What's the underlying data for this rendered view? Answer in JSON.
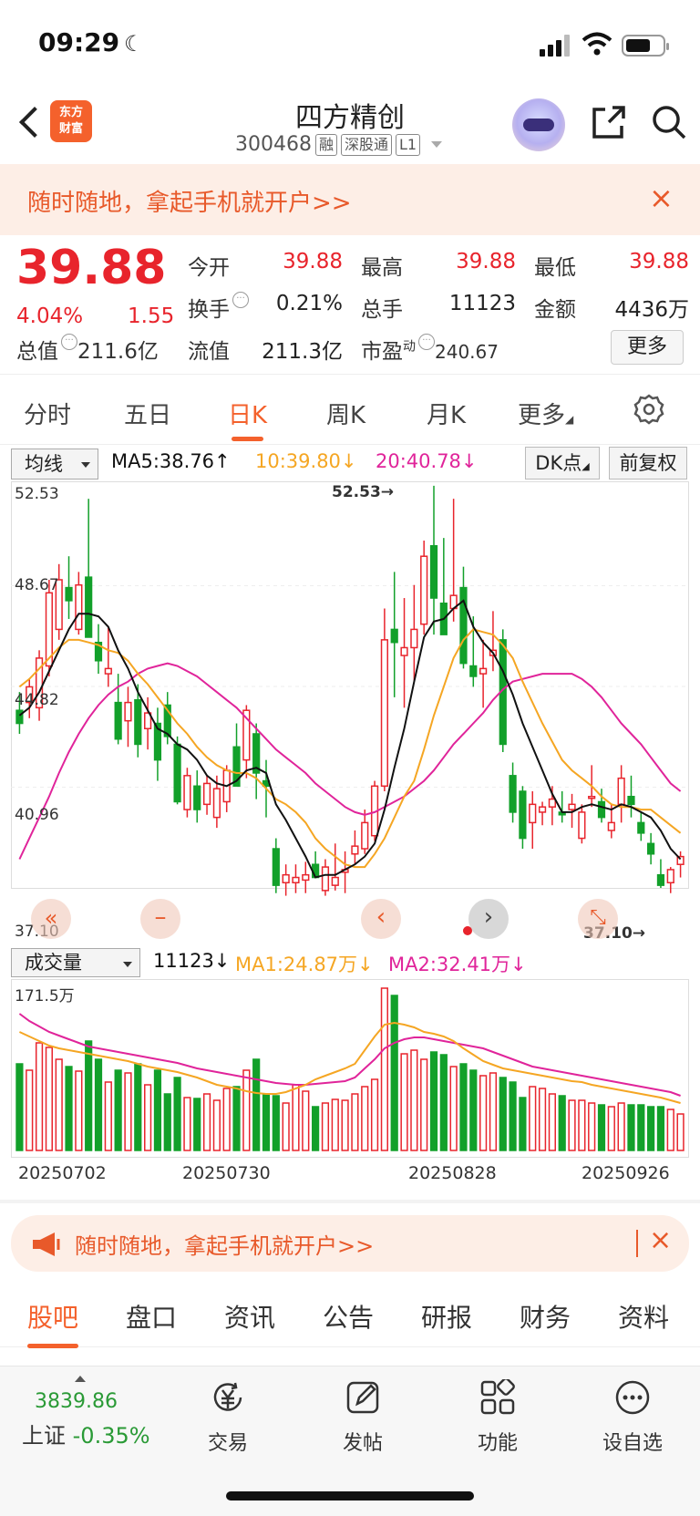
{
  "status": {
    "time": "09:29"
  },
  "nav": {
    "logo": "东方\n财富",
    "name": "四方精创",
    "code": "300468",
    "tags": [
      "融",
      "深股通",
      "L1"
    ]
  },
  "banner": {
    "text": "随时随地，拿起手机就开户>>",
    "close": "×"
  },
  "quote": {
    "price": "39.88",
    "pct": "4.04%",
    "chg": "1.55",
    "open_l": "今开",
    "open_v": "39.88",
    "high_l": "最高",
    "high_v": "39.88",
    "low_l": "最低",
    "low_v": "39.88",
    "turn_l": "换手",
    "turn_v": "0.21%",
    "vol_l": "总手",
    "vol_v": "11123",
    "amt_l": "金额",
    "amt_v": "4436万",
    "mcap_l": "总值",
    "mcap_v": "211.6亿",
    "fcap_l": "流值",
    "fcap_v": "211.3亿",
    "pe_l": "市盈",
    "pe_sup": "动",
    "pe_v": "240.67",
    "more": "更多"
  },
  "tabs": [
    "分时",
    "五日",
    "日K",
    "周K",
    "月K",
    "更多"
  ],
  "ma": {
    "select": "均线",
    "ma5": "MA5:38.76↑",
    "ma10": "10:39.80↓",
    "ma20": "20:40.78↓",
    "dk": "DK点",
    "fq": "前复权"
  },
  "chart_labels": {
    "y1": "52.53",
    "y2": "48.67",
    "y3": "44.82",
    "y4": "40.96",
    "y5": "37.10",
    "hi": "52.53→",
    "lo": "37.10→"
  },
  "vol": {
    "select": "成交量",
    "val": "11123↓",
    "ma1": "MA1:24.87万↓",
    "ma2": "MA2:32.41万↓",
    "ymax": "171.5万"
  },
  "dates": [
    "20250702",
    "20250730",
    "20250828",
    "20250926"
  ],
  "banner2": {
    "text": "随时随地，拿起手机就开户>>",
    "close": "×"
  },
  "ctabs": [
    "股吧",
    "盘口",
    "资讯",
    "公告",
    "研报",
    "财务",
    "资料"
  ],
  "bottom": {
    "idx": "3839.86",
    "idx_name": "上证",
    "idx_chg": "-0.35%",
    "btns": [
      "交易",
      "发帖",
      "功能",
      "设自选"
    ]
  },
  "colors": {
    "up": "#e8242c",
    "down": "#12a02a",
    "accent": "#f4612c",
    "ma5": "#111111",
    "ma10": "#f5a623",
    "ma20": "#e0249a"
  },
  "chart_data": {
    "type": "candlestick",
    "ylim": [
      37.1,
      52.53
    ],
    "x_ticks": [
      "20250702",
      "20250730",
      "20250828",
      "20250926"
    ],
    "ohlc": [
      [
        43.9,
        44.6,
        43.0,
        43.4
      ],
      [
        44.2,
        45.1,
        43.6,
        44.8
      ],
      [
        44.0,
        46.2,
        43.5,
        45.9
      ],
      [
        45.6,
        48.9,
        45.2,
        48.4
      ],
      [
        47.0,
        49.5,
        46.6,
        48.9
      ],
      [
        48.6,
        49.8,
        47.4,
        48.1
      ],
      [
        47.0,
        49.2,
        46.8,
        48.7
      ],
      [
        49.0,
        52.0,
        48.0,
        46.7
      ],
      [
        46.5,
        47.2,
        45.3,
        45.8
      ],
      [
        45.3,
        47.1,
        44.8,
        45.5
      ],
      [
        44.2,
        45.3,
        42.6,
        42.8
      ],
      [
        43.5,
        44.8,
        42.5,
        44.2
      ],
      [
        44.3,
        44.9,
        42.1,
        42.6
      ],
      [
        43.2,
        44.4,
        42.4,
        43.8
      ],
      [
        43.4,
        44.0,
        41.2,
        42.0
      ],
      [
        44.1,
        44.6,
        42.6,
        42.9
      ],
      [
        42.6,
        42.9,
        40.3,
        40.4
      ],
      [
        40.1,
        41.7,
        39.8,
        41.4
      ],
      [
        41.0,
        41.6,
        39.6,
        40.1
      ],
      [
        40.3,
        41.4,
        39.9,
        41.1
      ],
      [
        39.8,
        41.4,
        39.4,
        40.9
      ],
      [
        40.4,
        41.8,
        40.0,
        41.6
      ],
      [
        42.5,
        43.4,
        42.0,
        41.0
      ],
      [
        42.0,
        44.1,
        41.3,
        43.9
      ],
      [
        43.0,
        43.4,
        40.5,
        41.5
      ],
      [
        41.2,
        42.0,
        39.8,
        41.0
      ],
      [
        38.6,
        39.0,
        36.9,
        37.2
      ],
      [
        37.3,
        38.0,
        36.8,
        37.6
      ],
      [
        37.3,
        38.0,
        36.9,
        37.5
      ],
      [
        37.4,
        38.1,
        36.9,
        37.6
      ],
      [
        38.0,
        38.5,
        37.5,
        37.5
      ],
      [
        37.0,
        38.2,
        36.8,
        37.9
      ],
      [
        37.2,
        38.8,
        37.0,
        37.5
      ],
      [
        37.7,
        38.5,
        36.9,
        37.8
      ],
      [
        38.4,
        39.3,
        38.0,
        38.7
      ],
      [
        38.6,
        40.1,
        38.4,
        39.6
      ],
      [
        39.1,
        41.2,
        38.9,
        41.0
      ],
      [
        41.0,
        47.8,
        40.8,
        46.6
      ],
      [
        47.0,
        49.2,
        44.4,
        46.5
      ],
      [
        46.0,
        48.2,
        44.0,
        46.3
      ],
      [
        46.3,
        48.7,
        45.0,
        47.0
      ],
      [
        47.2,
        50.4,
        46.8,
        49.8
      ],
      [
        50.2,
        52.5,
        46.8,
        48.2
      ],
      [
        48.0,
        50.5,
        47.0,
        46.8
      ],
      [
        47.8,
        52.0,
        47.3,
        48.3
      ],
      [
        48.6,
        49.4,
        45.5,
        45.7
      ],
      [
        45.6,
        47.5,
        44.8,
        45.2
      ],
      [
        45.3,
        46.6,
        44.0,
        45.5
      ],
      [
        46.0,
        47.7,
        45.4,
        46.2
      ],
      [
        46.6,
        47.0,
        42.3,
        42.6
      ],
      [
        41.4,
        41.9,
        39.6,
        40.0
      ],
      [
        40.8,
        41.0,
        38.6,
        39.0
      ],
      [
        39.6,
        40.8,
        38.6,
        40.3
      ],
      [
        40.0,
        40.4,
        39.5,
        40.2
      ],
      [
        40.2,
        41.0,
        39.5,
        40.5
      ],
      [
        40.0,
        40.8,
        39.6,
        39.9
      ],
      [
        40.1,
        40.7,
        39.4,
        40.3
      ],
      [
        39.0,
        40.3,
        38.8,
        40.0
      ],
      [
        40.6,
        41.8,
        40.2,
        40.6
      ],
      [
        40.4,
        40.9,
        39.6,
        39.8
      ],
      [
        39.3,
        40.3,
        39.0,
        39.6
      ],
      [
        40.3,
        41.8,
        39.6,
        41.3
      ],
      [
        40.6,
        41.4,
        39.8,
        40.3
      ],
      [
        39.6,
        40.0,
        38.9,
        39.2
      ],
      [
        38.8,
        39.2,
        38.0,
        38.4
      ],
      [
        37.6,
        38.2,
        37.1,
        37.2
      ],
      [
        37.3,
        37.9,
        36.9,
        37.8
      ],
      [
        38.0,
        38.5,
        37.5,
        38.3
      ]
    ],
    "ma5": [
      43.7,
      44.0,
      44.6,
      45.4,
      46.2,
      47.0,
      47.6,
      47.6,
      47.5,
      47.1,
      46.2,
      45.5,
      44.6,
      43.9,
      43.2,
      43.0,
      42.6,
      42.4,
      42.0,
      41.4,
      41.1,
      41.0,
      41.2,
      41.6,
      41.7,
      41.5,
      40.3,
      39.7,
      39.0,
      38.3,
      37.5,
      37.6,
      37.6,
      37.8,
      38.0,
      38.3,
      38.8,
      40.1,
      41.7,
      43.2,
      45.0,
      46.7,
      47.3,
      47.4,
      47.8,
      48.1,
      47.1,
      46.5,
      46.1,
      45.4,
      44.5,
      43.4,
      42.5,
      41.6,
      40.7,
      40.0,
      40.0,
      40.2,
      40.3,
      40.2,
      40.1,
      40.3,
      40.2,
      40.0,
      39.8,
      39.3,
      38.6,
      38.2
    ],
    "ma10": [
      44.8,
      45.1,
      45.5,
      45.9,
      46.3,
      46.6,
      46.6,
      46.5,
      46.4,
      46.2,
      46.1,
      45.8,
      45.3,
      44.9,
      44.4,
      43.9,
      43.4,
      43.0,
      42.5,
      42.1,
      41.8,
      41.6,
      41.5,
      41.5,
      41.3,
      40.9,
      40.5,
      40.3,
      40.0,
      39.6,
      39.0,
      38.6,
      38.3,
      38.0,
      37.9,
      37.9,
      38.4,
      39.0,
      39.8,
      40.6,
      41.2,
      42.4,
      43.7,
      44.8,
      45.9,
      46.6,
      47.0,
      46.9,
      46.8,
      46.4,
      45.9,
      45.0,
      44.2,
      43.4,
      42.7,
      42.0,
      41.6,
      41.3,
      41.0,
      40.6,
      40.3,
      40.2,
      40.2,
      40.1,
      40.1,
      39.8,
      39.5,
      39.2
    ],
    "ma20": [
      38.2,
      39.0,
      39.8,
      40.6,
      41.5,
      42.3,
      43.0,
      43.6,
      44.1,
      44.5,
      44.8,
      45.0,
      45.3,
      45.5,
      45.6,
      45.7,
      45.6,
      45.4,
      45.2,
      44.9,
      44.6,
      44.3,
      44.0,
      43.6,
      43.2,
      42.8,
      42.4,
      42.1,
      41.8,
      41.5,
      41.1,
      40.8,
      40.5,
      40.2,
      40.0,
      39.9,
      40.0,
      40.2,
      40.4,
      40.6,
      40.9,
      41.2,
      41.6,
      42.1,
      42.6,
      43.0,
      43.4,
      43.8,
      44.3,
      44.7,
      45.0,
      45.1,
      45.2,
      45.3,
      45.3,
      45.3,
      45.3,
      45.1,
      44.8,
      44.4,
      43.9,
      43.4,
      43.0,
      42.6,
      42.1,
      41.6,
      41.1,
      40.8
    ],
    "volume": [
      95,
      88,
      118,
      113,
      100,
      92,
      87,
      120,
      100,
      75,
      88,
      85,
      95,
      72,
      88,
      62,
      80,
      58,
      57,
      62,
      55,
      68,
      70,
      88,
      100,
      62,
      60,
      52,
      72,
      65,
      48,
      52,
      56,
      55,
      62,
      70,
      78,
      178,
      170,
      106,
      110,
      100,
      108,
      105,
      92,
      95,
      88,
      82,
      85,
      80,
      75,
      58,
      70,
      68,
      62,
      60,
      55,
      55,
      52,
      50,
      48,
      52,
      50,
      50,
      48,
      48,
      45,
      40
    ],
    "vol_ma1": [
      130,
      125,
      120,
      115,
      112,
      110,
      108,
      106,
      104,
      102,
      100,
      98,
      95,
      92,
      90,
      88,
      86,
      83,
      80,
      76,
      72,
      70,
      68,
      65,
      63,
      62,
      62,
      64,
      68,
      72,
      78,
      82,
      86,
      90,
      95,
      110,
      125,
      138,
      140,
      138,
      135,
      130,
      128,
      125,
      120,
      112,
      105,
      98,
      94,
      90,
      88,
      86,
      84,
      82,
      80,
      78,
      76,
      75,
      72,
      70,
      68,
      66,
      64,
      62,
      60,
      58,
      55,
      52
    ],
    "vol_ma2": [
      150,
      142,
      136,
      130,
      126,
      122,
      118,
      114,
      112,
      110,
      108,
      106,
      104,
      102,
      100,
      98,
      96,
      93,
      90,
      88,
      86,
      84,
      82,
      80,
      78,
      76,
      74,
      73,
      72,
      72,
      73,
      74,
      75,
      76,
      80,
      90,
      100,
      112,
      118,
      122,
      124,
      124,
      122,
      120,
      118,
      116,
      114,
      112,
      108,
      104,
      100,
      96,
      92,
      90,
      88,
      86,
      84,
      82,
      80,
      78,
      76,
      74,
      72,
      70,
      68,
      66,
      64,
      60
    ]
  }
}
